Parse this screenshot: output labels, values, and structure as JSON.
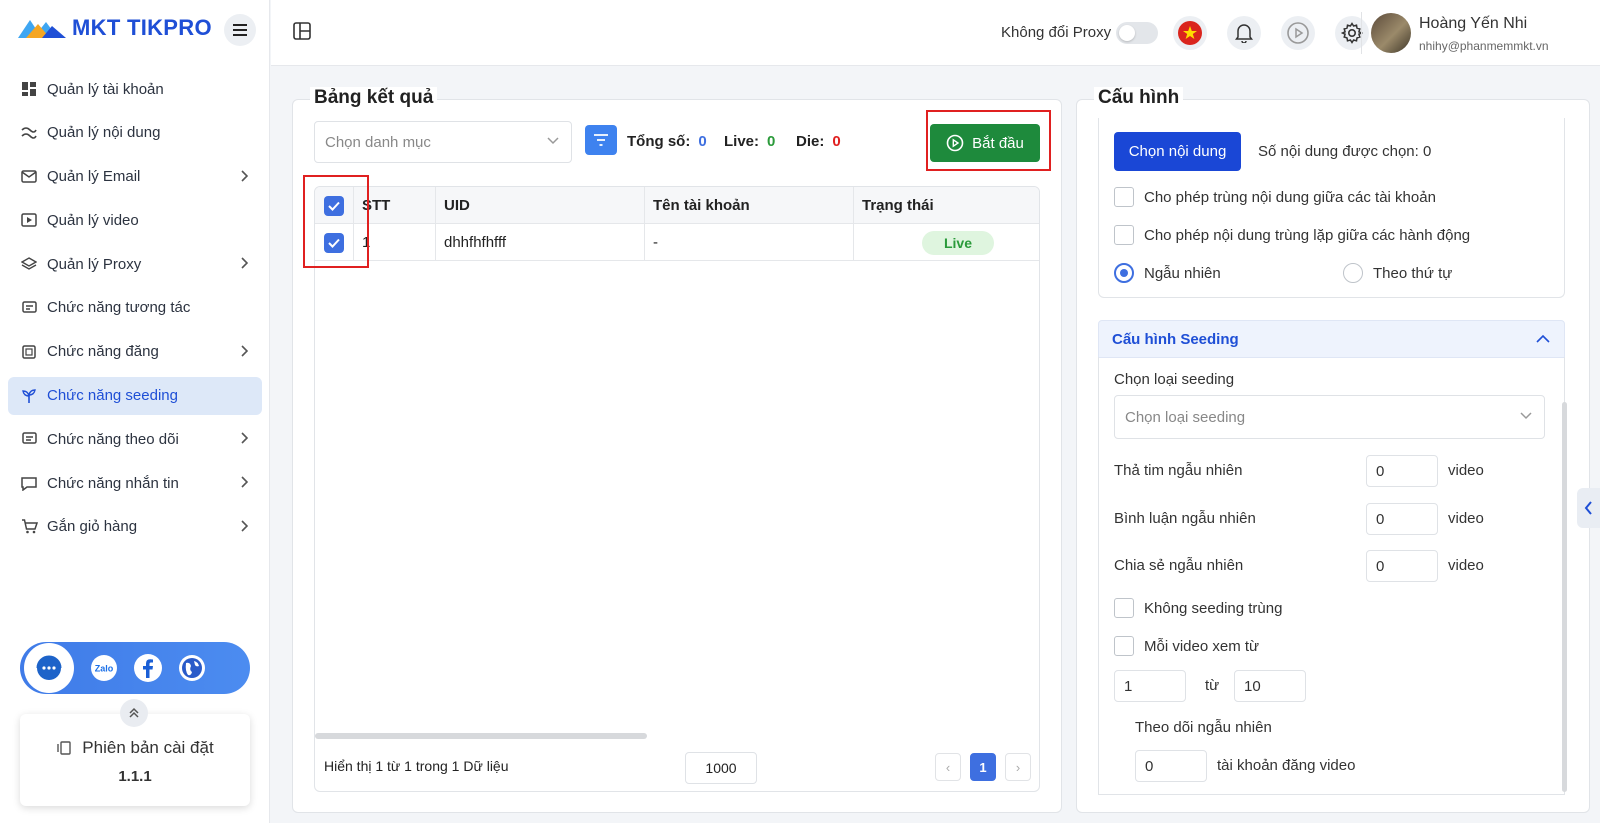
{
  "app": {
    "logo_text": "MKT TIKPRO"
  },
  "sidebar": {
    "items": [
      {
        "label": "Quản lý tài khoản",
        "icon": "dashboard-icon",
        "has_children": false
      },
      {
        "label": "Quản lý nội dung",
        "icon": "content-icon",
        "has_children": false
      },
      {
        "label": "Quản lý Email",
        "icon": "email-icon",
        "has_children": true
      },
      {
        "label": "Quản lý video",
        "icon": "video-icon",
        "has_children": false
      },
      {
        "label": "Quản lý Proxy",
        "icon": "layers-icon",
        "has_children": true
      },
      {
        "label": "Chức năng tương tác",
        "icon": "interaction-icon",
        "has_children": false
      },
      {
        "label": "Chức năng đăng",
        "icon": "post-icon",
        "has_children": true
      },
      {
        "label": "Chức năng seeding",
        "icon": "sprout-icon",
        "has_children": false,
        "active": true
      },
      {
        "label": "Chức năng theo dõi",
        "icon": "follow-icon",
        "has_children": true
      },
      {
        "label": "Chức năng nhắn tin",
        "icon": "message-icon",
        "has_children": true
      },
      {
        "label": "Gắn giỏ hàng",
        "icon": "cart-icon",
        "has_children": true
      }
    ],
    "social": {
      "support": "support-chat-icon",
      "zalo_text": "Zalo",
      "facebook": "facebook-icon",
      "web": "globe-icon"
    },
    "version": {
      "label": "Phiên bản cài đặt",
      "number": "1.1.1"
    }
  },
  "topbar": {
    "proxy_label": "Không đổi Proxy",
    "proxy_toggle_on": false,
    "user": {
      "name": "Hoàng Yến Nhi",
      "email": "nhihy@phanmemmkt.vn"
    }
  },
  "results": {
    "title": "Bảng kết quả",
    "category_placeholder": "Chọn danh mục",
    "total_label": "Tổng số:",
    "total_value": "0",
    "live_label": "Live:",
    "live_value": "0",
    "die_label": "Die:",
    "die_value": "0",
    "start_label": "Bắt đầu",
    "columns": [
      "STT",
      "UID",
      "Tên tài khoản",
      "Trạng thái"
    ],
    "rows": [
      {
        "stt": "1",
        "uid": "dhhfhfhfff",
        "name": "-",
        "status": "Live",
        "checked": true
      }
    ],
    "footer_text": "Hiển thị 1 từ 1 trong 1 Dữ liệu",
    "page_size": "1000",
    "current_page": "1",
    "prev": "‹",
    "next": "›"
  },
  "config": {
    "title": "Cấu hình",
    "choose_content_label": "Chọn nội dung",
    "selected_count_label": "Số nội dung được chọn: 0",
    "allow_dup_accounts": "Cho phép trùng nội dung giữa các tài khoản",
    "allow_dup_actions": "Cho phép nội dung trùng lặp giữa các hành động",
    "random_label": "Ngẫu nhiên",
    "sequential_label": "Theo thứ tự",
    "seeding": {
      "title": "Cấu hình Seeding",
      "type_label": "Chọn loại seeding",
      "type_placeholder": "Chọn loại seeding",
      "heart_label": "Thả tim ngẫu nhiên",
      "heart_value": "0",
      "comment_label": "Bình luận ngẫu nhiên",
      "comment_value": "0",
      "share_label": "Chia sẻ ngẫu nhiên",
      "share_value": "0",
      "unit_video": "video",
      "no_dup_label": "Không seeding trùng",
      "watch_label": "Mỗi video xem từ",
      "watch_from": "1",
      "watch_to_label": "từ",
      "watch_to": "10",
      "follow_label": "Theo dõi ngẫu nhiên",
      "follow_value": "0",
      "follow_unit": "tài khoản đăng video"
    }
  },
  "colors": {
    "primary": "#1a47d6",
    "accent": "#3e6fe0",
    "start_green": "#1e8a3c",
    "live_green": "#2a9a3a",
    "die_red": "#e02020",
    "highlight_red": "#e02020"
  }
}
